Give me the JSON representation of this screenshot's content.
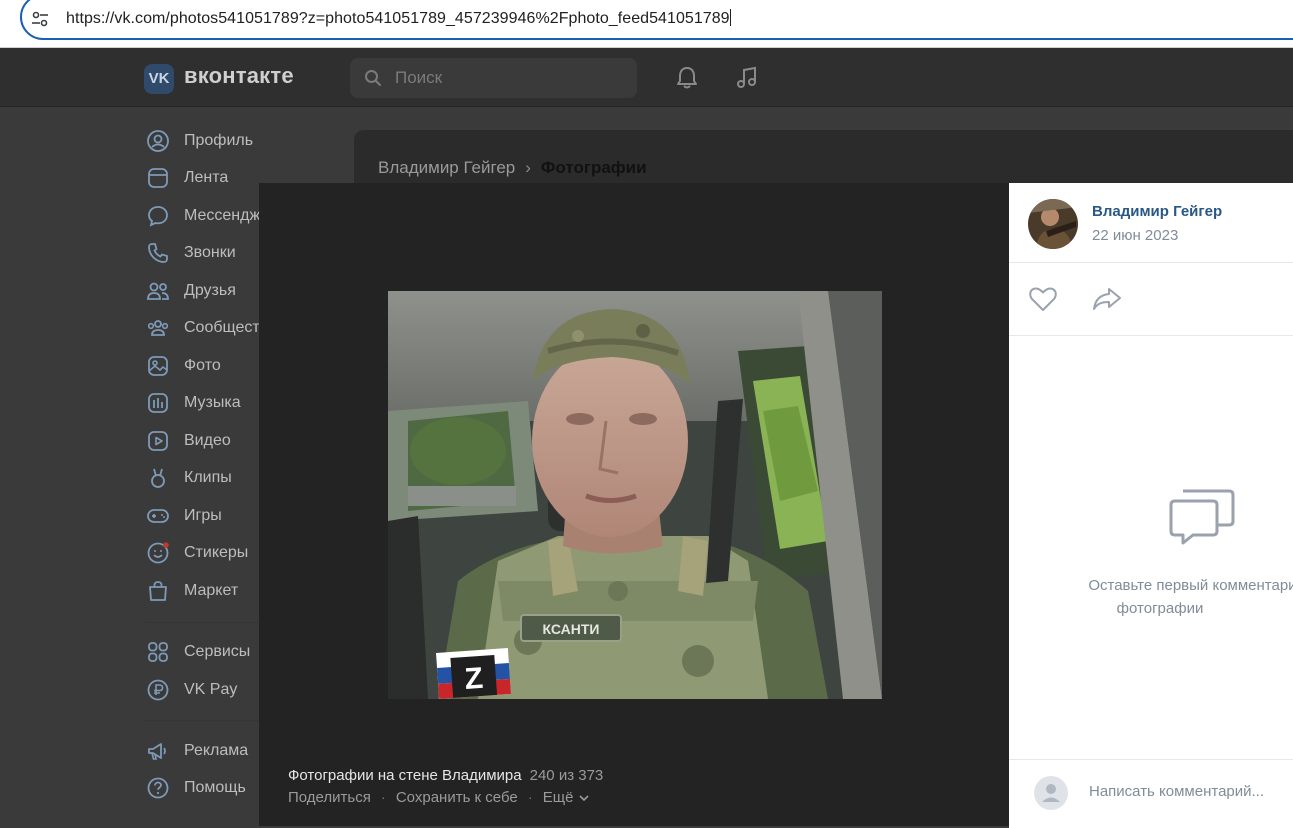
{
  "browser": {
    "url": "https://vk.com/photos541051789?z=photo541051789_457239946%2Fphoto_feed541051789",
    "site_info_icon": "tune-icon"
  },
  "header": {
    "logo_mark": "VK",
    "logo_text": "вконтакте",
    "search_placeholder": "Поиск",
    "icons": [
      "bell-icon",
      "music-note-icon"
    ]
  },
  "sidebar": {
    "items": [
      {
        "label": "Профиль",
        "icon": "profile-icon"
      },
      {
        "label": "Лента",
        "icon": "feed-icon"
      },
      {
        "label": "Мессенджер",
        "icon": "messenger-icon"
      },
      {
        "label": "Звонки",
        "icon": "phone-icon"
      },
      {
        "label": "Друзья",
        "icon": "friends-icon"
      },
      {
        "label": "Сообщества",
        "icon": "communities-icon"
      },
      {
        "label": "Фото",
        "icon": "photo-icon"
      },
      {
        "label": "Музыка",
        "icon": "music-icon"
      },
      {
        "label": "Видео",
        "icon": "video-icon"
      },
      {
        "label": "Клипы",
        "icon": "clips-icon"
      },
      {
        "label": "Игры",
        "icon": "games-icon"
      },
      {
        "label": "Стикеры",
        "icon": "stickers-icon"
      },
      {
        "label": "Маркет",
        "icon": "market-icon"
      },
      {
        "label": "Сервисы",
        "icon": "services-icon"
      },
      {
        "label": "VK Pay",
        "icon": "vkpay-icon"
      },
      {
        "label": "Реклама",
        "icon": "ads-icon"
      },
      {
        "label": "Помощь",
        "icon": "help-icon"
      }
    ]
  },
  "breadcrumb": {
    "parent": "Владимир Гейгер",
    "current": "Фотографии"
  },
  "viewer": {
    "album_title": "Фотографии на стене Владимира",
    "counter": "240 из 373",
    "actions": [
      "Поделиться",
      "Сохранить к себе",
      "Ещё"
    ],
    "photo_badge_text": "КСАНТИ",
    "patch_letter": "Z"
  },
  "panel": {
    "author": "Владимир Гейгер",
    "date": "22 июн 2023",
    "empty_comments_line1": "Оставьте первый комментарий к",
    "empty_comments_line2": "фотографии",
    "comment_placeholder": "Написать комментарий..."
  },
  "colors": {
    "accent": "#2a5885",
    "muted": "#818c99",
    "address_border": "#1a5fb4"
  }
}
